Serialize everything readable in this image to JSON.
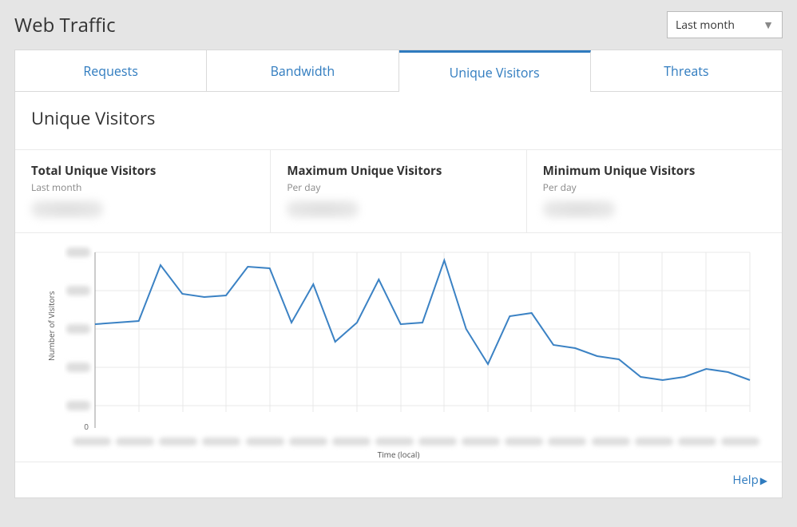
{
  "header": {
    "title": "Web Traffic"
  },
  "range_select": {
    "selected": "Last month"
  },
  "tabs": {
    "requests": "Requests",
    "bandwidth": "Bandwidth",
    "unique_visitors": "Unique Visitors",
    "threats": "Threats"
  },
  "section": {
    "title": "Unique Visitors"
  },
  "stats": {
    "total": {
      "title": "Total Unique Visitors",
      "sub": "Last month"
    },
    "max": {
      "title": "Maximum Unique Visitors",
      "sub": "Per day"
    },
    "min": {
      "title": "Minimum Unique Visitors",
      "sub": "Per day"
    }
  },
  "chart": {
    "ylabel": "Number of Visitors",
    "xlabel": "Time (local)",
    "y_zero": "0"
  },
  "help": {
    "label": "Help"
  },
  "chart_data": {
    "type": "line",
    "title": "Unique Visitors",
    "xlabel": "Time (local)",
    "ylabel": "Number of Visitors",
    "note": "Axis tick labels and exact values are blurred/redacted in the screenshot; values below are relative estimates (0–100 scale) read from the plotted line shape over 31 evenly-spaced days.",
    "x": [
      1,
      2,
      3,
      4,
      5,
      6,
      7,
      8,
      9,
      10,
      11,
      12,
      13,
      14,
      15,
      16,
      17,
      18,
      19,
      20,
      21,
      22,
      23,
      24,
      25,
      26,
      27,
      28,
      29,
      30,
      31
    ],
    "values": [
      55,
      56,
      57,
      92,
      74,
      72,
      73,
      91,
      90,
      56,
      80,
      44,
      56,
      83,
      55,
      56,
      95,
      52,
      30,
      60,
      62,
      42,
      40,
      35,
      33,
      22,
      20,
      22,
      27,
      25,
      20
    ],
    "ylim_relative": [
      0,
      100
    ]
  }
}
